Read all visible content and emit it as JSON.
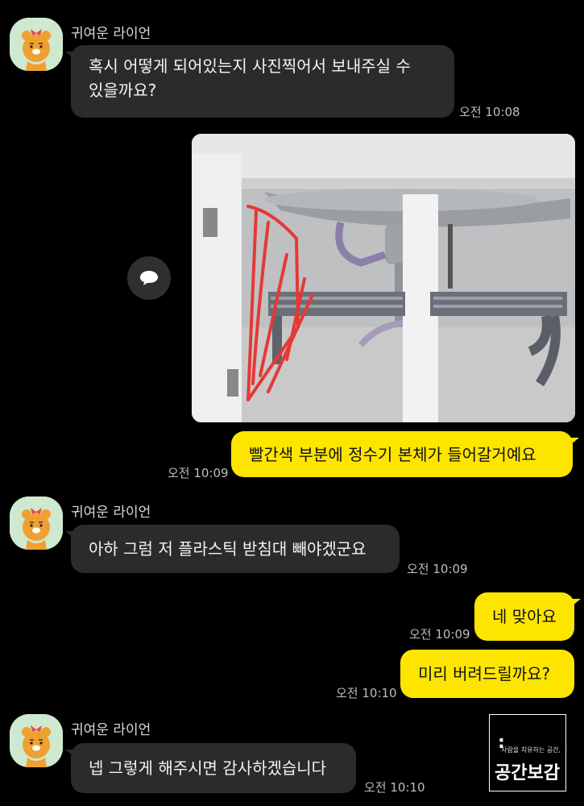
{
  "messages": {
    "m1": {
      "sender": "귀여운 라이언",
      "line1": "혹시 어떻게 되어있는지 사진찍어서 보내주실 수",
      "line2": "있을까요?",
      "time": "오전 10:08"
    },
    "m2": {
      "text": "빨간색 부분에 정수기 본체가 들어갈거예요",
      "time": "오전 10:09"
    },
    "m3": {
      "sender": "귀여운 라이언",
      "text": "아하 그럼 저 플라스틱 받침대 빼야겠군요",
      "time": "오전 10:09"
    },
    "m4": {
      "text": "네 맞아요",
      "time": "오전 10:09"
    },
    "m5": {
      "text": "미리 버려드릴까요?",
      "time": "오전 10:10"
    },
    "m6": {
      "sender": "귀여운 라이언",
      "text": "넵 그렇게 해주시면 감사하겠습니다",
      "time": "오전 10:10"
    }
  },
  "watermark": {
    "mark": ":",
    "tagline": "사람을 치유하는 공간,",
    "name": "공간보감"
  },
  "icons": {
    "avatar": "ryan-character-avatar",
    "share": "speech-bubble-icon",
    "photo": "sink-cabinet-photo"
  },
  "colors": {
    "background": "#000000",
    "incoming_bubble": "#2b2b2b",
    "outgoing_bubble": "#fee500",
    "avatar_bg": "#cfe9cf"
  }
}
